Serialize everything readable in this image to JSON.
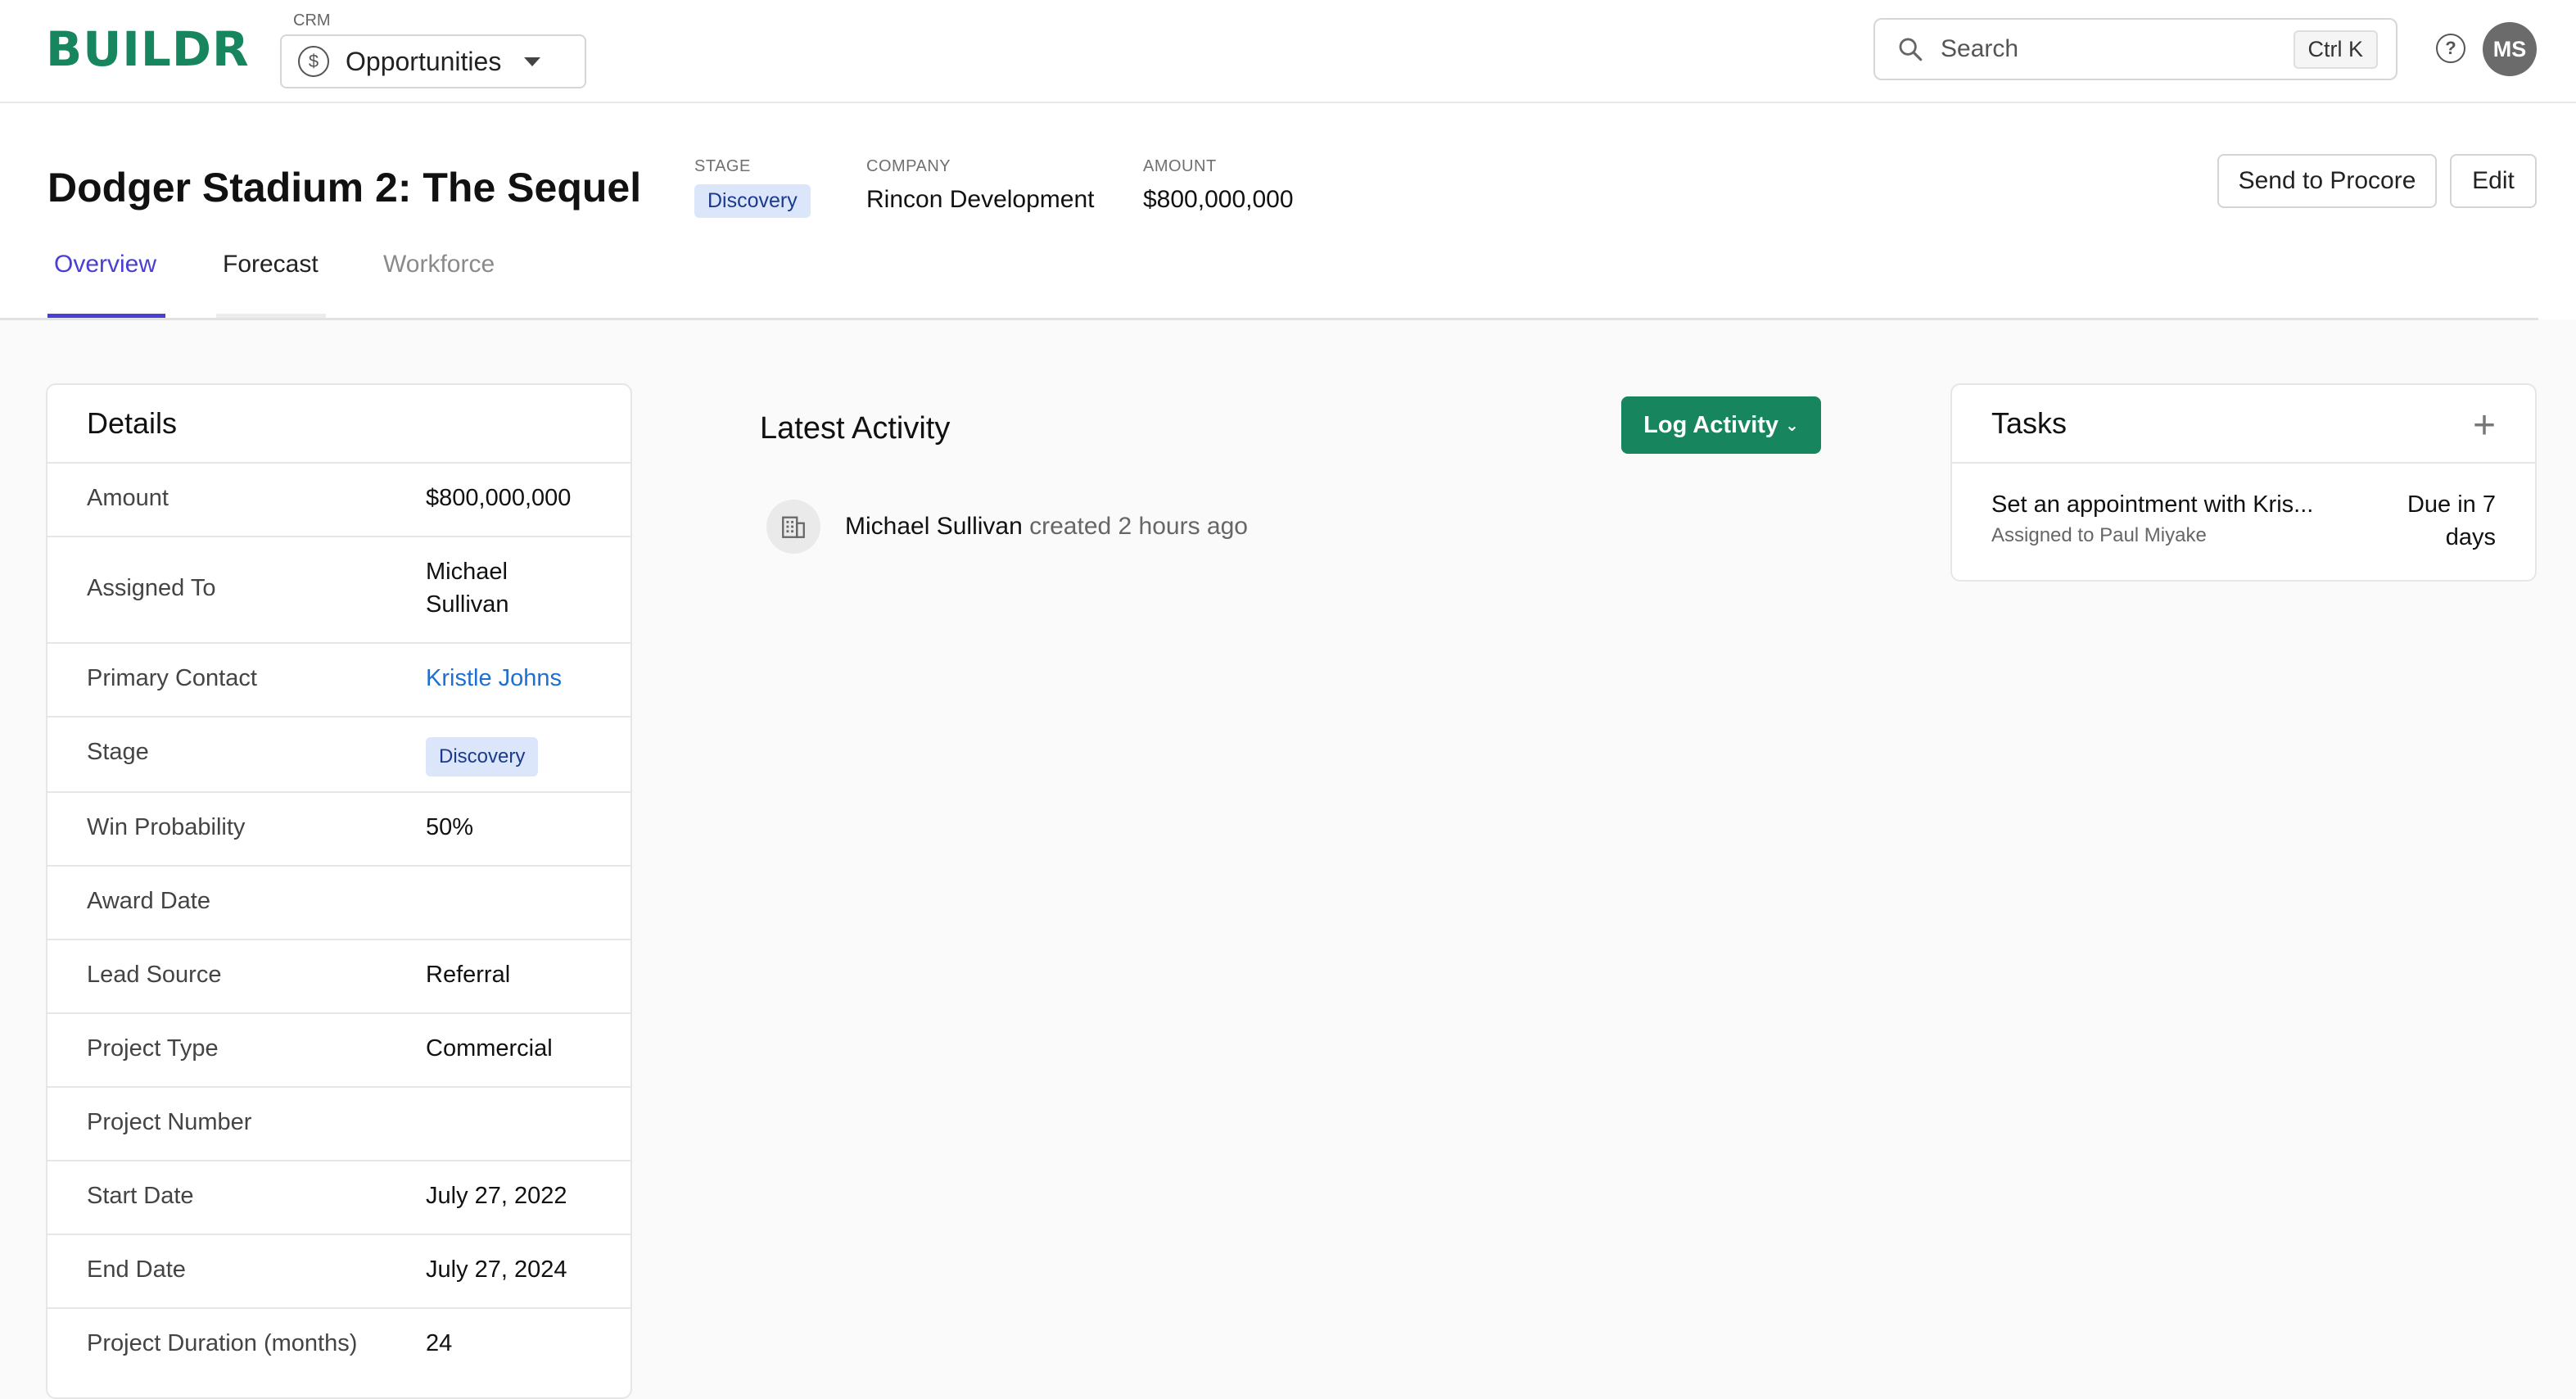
{
  "topbar": {
    "logo": "BUILDR",
    "module_caption": "CRM",
    "module_name": "Opportunities",
    "search_placeholder": "Search",
    "search_shortcut": "Ctrl K",
    "avatar_initials": "MS",
    "icons": [
      "dollar-circle-icon",
      "caret-down-icon",
      "search-icon",
      "help-icon"
    ]
  },
  "header": {
    "title": "Dodger Stadium 2: The Sequel",
    "stage_label": "STAGE",
    "stage_value": "Discovery",
    "company_label": "COMPANY",
    "company_value": "Rincon Development",
    "amount_label": "AMOUNT",
    "amount_value": "$800,000,000",
    "send_button": "Send to Procore",
    "edit_button": "Edit"
  },
  "tabs": [
    {
      "label": "Overview",
      "state": "active"
    },
    {
      "label": "Forecast",
      "state": "normal"
    },
    {
      "label": "Workforce",
      "state": "muted"
    }
  ],
  "details": {
    "title": "Details",
    "rows": [
      {
        "label": "Amount",
        "value": "$800,000,000"
      },
      {
        "label": "Assigned To",
        "value_line1": "Michael",
        "value_line2": "Sullivan"
      },
      {
        "label": "Primary Contact",
        "value": "Kristle Johns"
      },
      {
        "label": "Stage",
        "value": "Discovery"
      },
      {
        "label": "Win Probability",
        "value": "50%"
      },
      {
        "label": "Award Date",
        "value": ""
      },
      {
        "label": "Lead Source",
        "value": "Referral"
      },
      {
        "label": "Project Type",
        "value": "Commercial"
      },
      {
        "label": "Project Number",
        "value": ""
      },
      {
        "label": "Start Date",
        "value": "July 27, 2022"
      },
      {
        "label": "End Date",
        "value": "July 27, 2024"
      },
      {
        "label": "Project Duration (months)",
        "value": "24"
      }
    ]
  },
  "activity": {
    "title": "Latest Activity",
    "log_button": "Log Activity",
    "entries": [
      {
        "who": "Michael Sullivan",
        "what": "created 2 hours ago",
        "icon": "building-icon"
      }
    ]
  },
  "tasks": {
    "title": "Tasks",
    "add_icon": "plus-icon",
    "items": [
      {
        "title": "Set an appointment with Kris...",
        "assigned": "Assigned to Paul Miyake",
        "due_line1": "Due in 7",
        "due_line2": "days"
      }
    ]
  },
  "colors": {
    "brand_green": "#17855d",
    "tab_active": "#4a3fd3",
    "badge_bg": "#dbe6fb",
    "badge_text": "#1b3a8a",
    "link": "#1f6fd1"
  }
}
